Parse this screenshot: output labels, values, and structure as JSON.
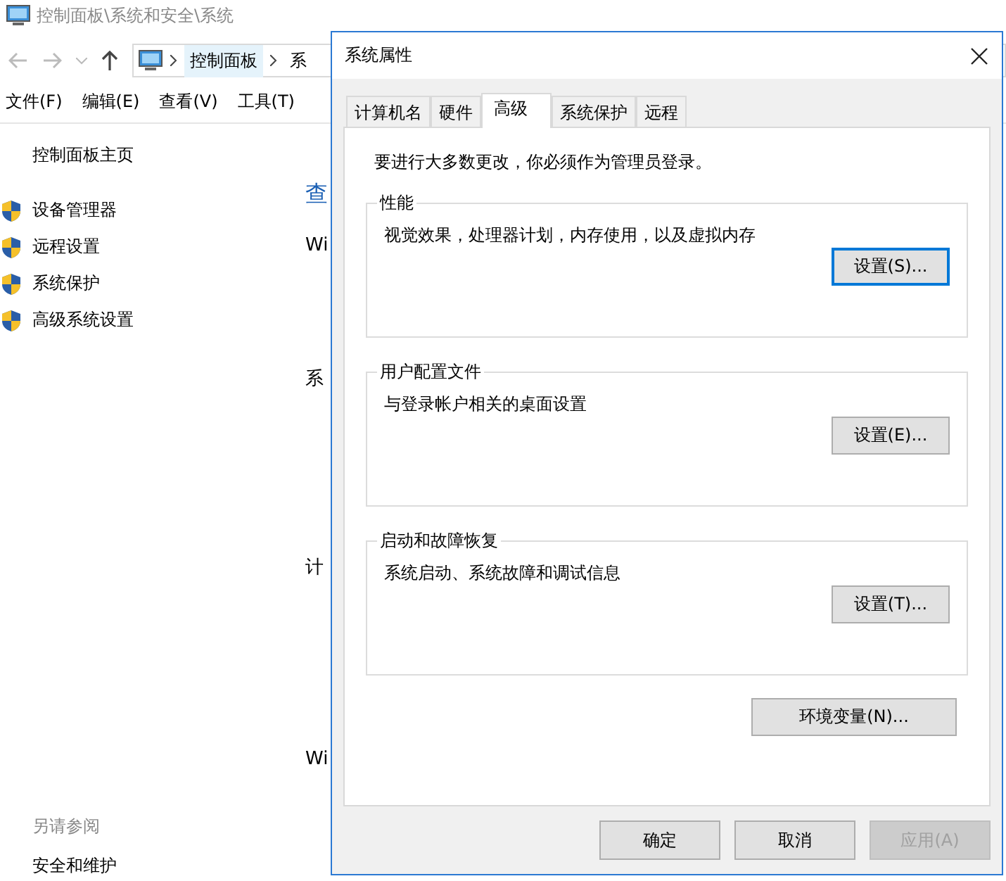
{
  "explorer": {
    "title": "控制面板\\系统和安全\\系统",
    "address": [
      "控制面板",
      "系"
    ],
    "menu": [
      "文件(F)",
      "编辑(E)",
      "查看(V)",
      "工具(T)"
    ],
    "sidebar": {
      "home": "控制面板主页",
      "tasks": [
        "设备管理器",
        "远程设置",
        "系统保护",
        "高级系统设置"
      ],
      "see_also_heading": "另请参阅",
      "see_also": [
        "安全和维护"
      ]
    },
    "content_fragments": [
      {
        "text": "查",
        "kind": "link"
      },
      {
        "text": "Wi",
        "kind": "text"
      },
      {
        "text": "系",
        "kind": "text"
      },
      {
        "text": "计",
        "kind": "text"
      },
      {
        "text": "Wi",
        "kind": "text"
      }
    ]
  },
  "dialog": {
    "title": "系统属性",
    "tabs": [
      {
        "label": "计算机名",
        "selected": false
      },
      {
        "label": "硬件",
        "selected": false
      },
      {
        "label": "高级",
        "selected": true
      },
      {
        "label": "系统保护",
        "selected": false
      },
      {
        "label": "远程",
        "selected": false
      }
    ],
    "notice": "要进行大多数更改，你必须作为管理员登录。",
    "groups": [
      {
        "title": "性能",
        "description": "视觉效果，处理器计划，内存使用，以及虚拟内存",
        "button": "设置(S)...",
        "focused": true
      },
      {
        "title": "用户配置文件",
        "description": "与登录帐户相关的桌面设置",
        "button": "设置(E)...",
        "focused": false
      },
      {
        "title": "启动和故障恢复",
        "description": "系统启动、系统故障和调试信息",
        "button": "设置(T)...",
        "focused": false
      }
    ],
    "env_button": "环境变量(N)...",
    "buttons": [
      {
        "label": "确定",
        "disabled": false
      },
      {
        "label": "取消",
        "disabled": false
      },
      {
        "label": "应用(A)",
        "disabled": true
      }
    ]
  }
}
